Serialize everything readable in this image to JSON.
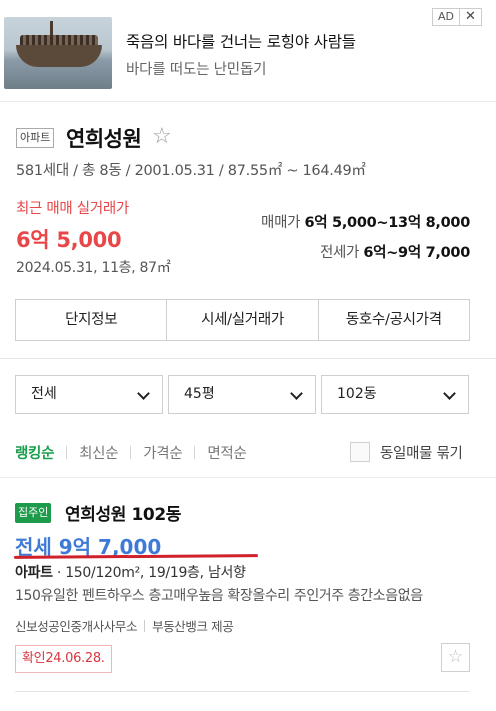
{
  "ad": {
    "title": "죽음의 바다를 건너는 로힝야 사람들",
    "subtitle": "바다를 떠도는 난민돕기",
    "badge": "AD",
    "close": "✕",
    "image_icon": "refugee-boat-photo"
  },
  "complex": {
    "tag": "아파트",
    "name": "연희성원",
    "star_icon": "☆",
    "meta": "581세대 / 총 8동 / 2001.05.31 / 87.55㎡ ~ 164.49㎡",
    "recent_label": "최근 매매 실거래가",
    "recent_price": "6억 5,000",
    "recent_date": "2024.05.31, 11층, 87㎡",
    "sale_label": "매매가",
    "sale_range": "6억 5,000~13억 8,000",
    "jeonse_label": "전세가",
    "jeonse_range": "6억~9억 7,000"
  },
  "tabs": [
    "단지정보",
    "시세/실거래가",
    "동호수/공시가격"
  ],
  "filters": {
    "deal_type": "전세",
    "area": "45평",
    "building": "102동"
  },
  "sort": {
    "items": [
      "랭킹순",
      "최신순",
      "가격순",
      "면적순"
    ],
    "active": "랭킹순",
    "group_label": "동일매물 묶기"
  },
  "listing": {
    "badge": "집주인",
    "title": "연희성원 102동",
    "price": "전세 9억 7,000",
    "type": "아파트",
    "spec": "150/120m², 19/19층, 남서향",
    "description": "150유일한 펜트하우스 층고매우높음 확장올수리 주인거주 층간소음없음",
    "agent": "신보성공인중개사사무소",
    "provider": "부동산뱅크 제공",
    "confirmed": "확인24.06.28.",
    "fav_icon": "☆"
  },
  "colors": {
    "accent_red": "#e8474a",
    "price_blue": "#3f7bd6",
    "brand_green": "#1e9b4a",
    "annotation_red": "#d0202a"
  }
}
